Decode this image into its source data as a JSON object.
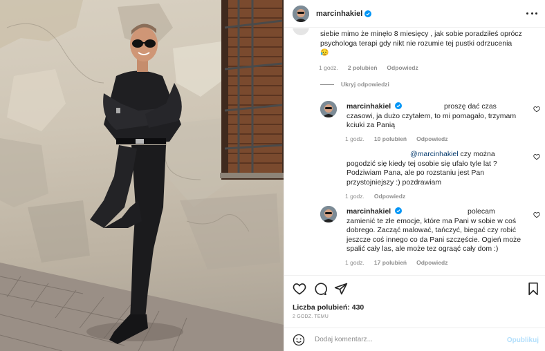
{
  "post": {
    "username": "marcinhakiel",
    "more_icon": "more-horizontal-icon",
    "verified_color": "#0095f6"
  },
  "comments": {
    "top_comment": {
      "text_line1": "siebie mimo że minęło 8 miesięcy , jak sobie poradziłeś oprócz",
      "text_line2": "psychologa terapi gdy nikt nie rozumie tej pustki odrzucenia",
      "emoji": "😥",
      "time": "1 godz.",
      "likes": "2 polubień",
      "reply": "Odpowiedz"
    },
    "hide_replies": "Ukryj odpowiedzi",
    "replies": [
      {
        "username": "marcinhakiel",
        "lines": [
          "proszę dać czas",
          "czasowi, ja dużo czytałem, to mi pomagało, trzymam",
          "kciuki za Panią"
        ],
        "time": "1 godz.",
        "likes": "10 polubień",
        "reply": "Odpowiedz"
      },
      {
        "mention": "@marcinhakiel",
        "lines": [
          "czy można",
          "pogodzić się kiedy tej osobie się ufało tyle lat ?",
          "Podziwiam Pana, ale po rozstaniu jest Pan",
          "przystojniejszy :) pozdrawiam"
        ],
        "time": "1 godz.",
        "reply": "Odpowiedz"
      },
      {
        "username": "marcinhakiel",
        "lines": [
          "polecam",
          "zamienić te złe emocje, które ma Pani w sobie w coś",
          "dobrego. Zacząć malować, tańczyć, biegać czy robić",
          "jeszcze coś innego co da Pani szczęście. Ogień może",
          "spalić cały las, ale może tez ograąć cały dom :)"
        ],
        "time": "1 godz.",
        "likes": "17 polubień",
        "reply": "Odpowiedz"
      }
    ]
  },
  "actions": {
    "icons": [
      "heart-icon",
      "comment-icon",
      "share-icon",
      "bookmark-icon"
    ],
    "likes_label": "Liczba polubień: 430",
    "time_ago": "2 GODZ. TEMU"
  },
  "add_comment": {
    "placeholder": "Dodaj komentarz...",
    "publish_label": "Opublikuj",
    "publish_color": "#b2dffc"
  }
}
